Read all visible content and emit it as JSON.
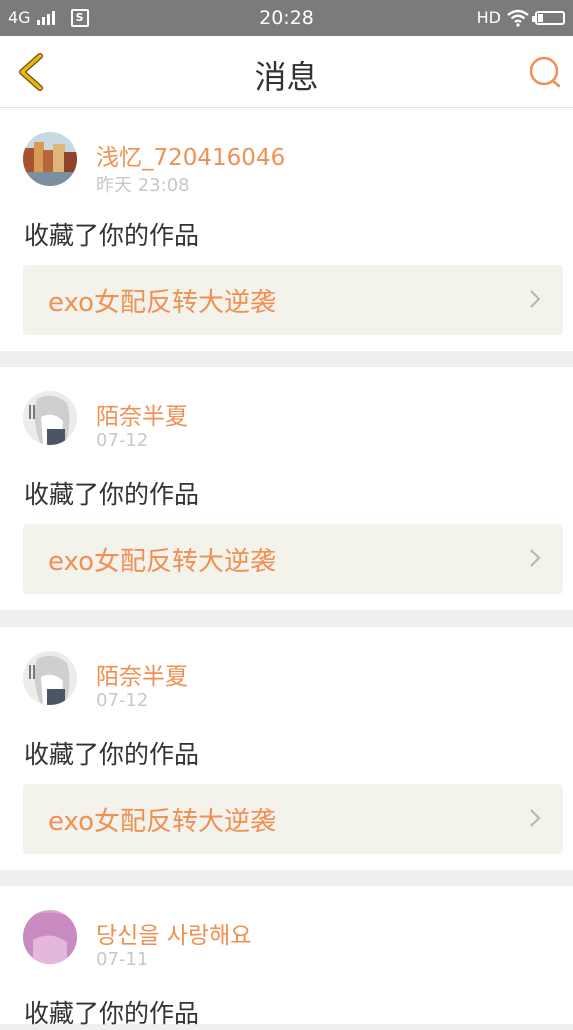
{
  "status_bar": {
    "network": "4G",
    "time": "20:28",
    "hd": "HD"
  },
  "header": {
    "title": "消息"
  },
  "colors": {
    "accent": "#f09054",
    "back_arrow": "#f5b400",
    "card_bg": "#f3f3ec"
  },
  "messages": [
    {
      "user": "浅忆_720416046",
      "time": "昨天 23:08",
      "action": "收藏了你的作品",
      "work_title": "exo女配反转大逆袭",
      "avatar": "city-photo-avatar"
    },
    {
      "user": "陌奈半夏",
      "time": "07-12",
      "action": "收藏了你的作品",
      "work_title": "exo女配反转大逆袭",
      "avatar": "anime-girl-avatar"
    },
    {
      "user": "陌奈半夏",
      "time": "07-12",
      "action": "收藏了你的作品",
      "work_title": "exo女配反转大逆袭",
      "avatar": "anime-girl-avatar"
    },
    {
      "user": "당신을 사랑해요",
      "time": "07-11",
      "action": "收藏了你的作品",
      "work_title": "",
      "avatar": "pink-avatar"
    }
  ]
}
